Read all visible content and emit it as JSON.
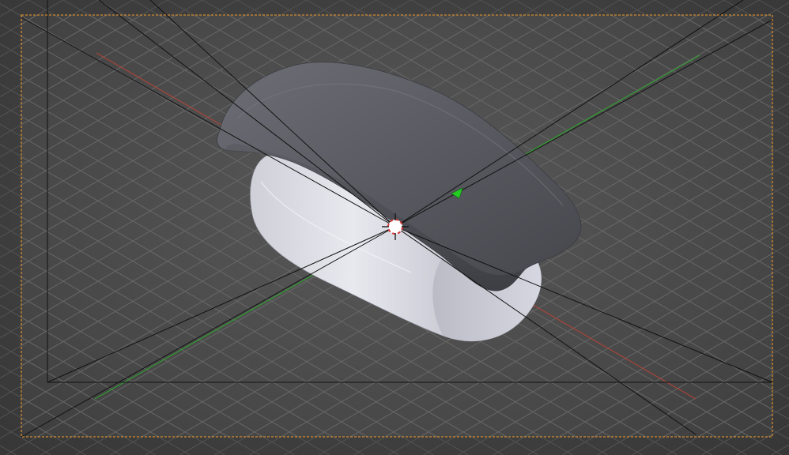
{
  "viewport": {
    "mode": "camera-view",
    "colors": {
      "background": "#555555",
      "grid": "#6a6a6a",
      "camera_frame": "#d08a2e",
      "axis_x": "#a8443a",
      "axis_y": "#2f9a2f",
      "cover_mesh": "#5a5b62",
      "inner_mesh": "#d8d8e2",
      "cursor": "#d63a3a",
      "selection_marker": "#22cc22",
      "guide_lines": "#111111"
    }
  }
}
